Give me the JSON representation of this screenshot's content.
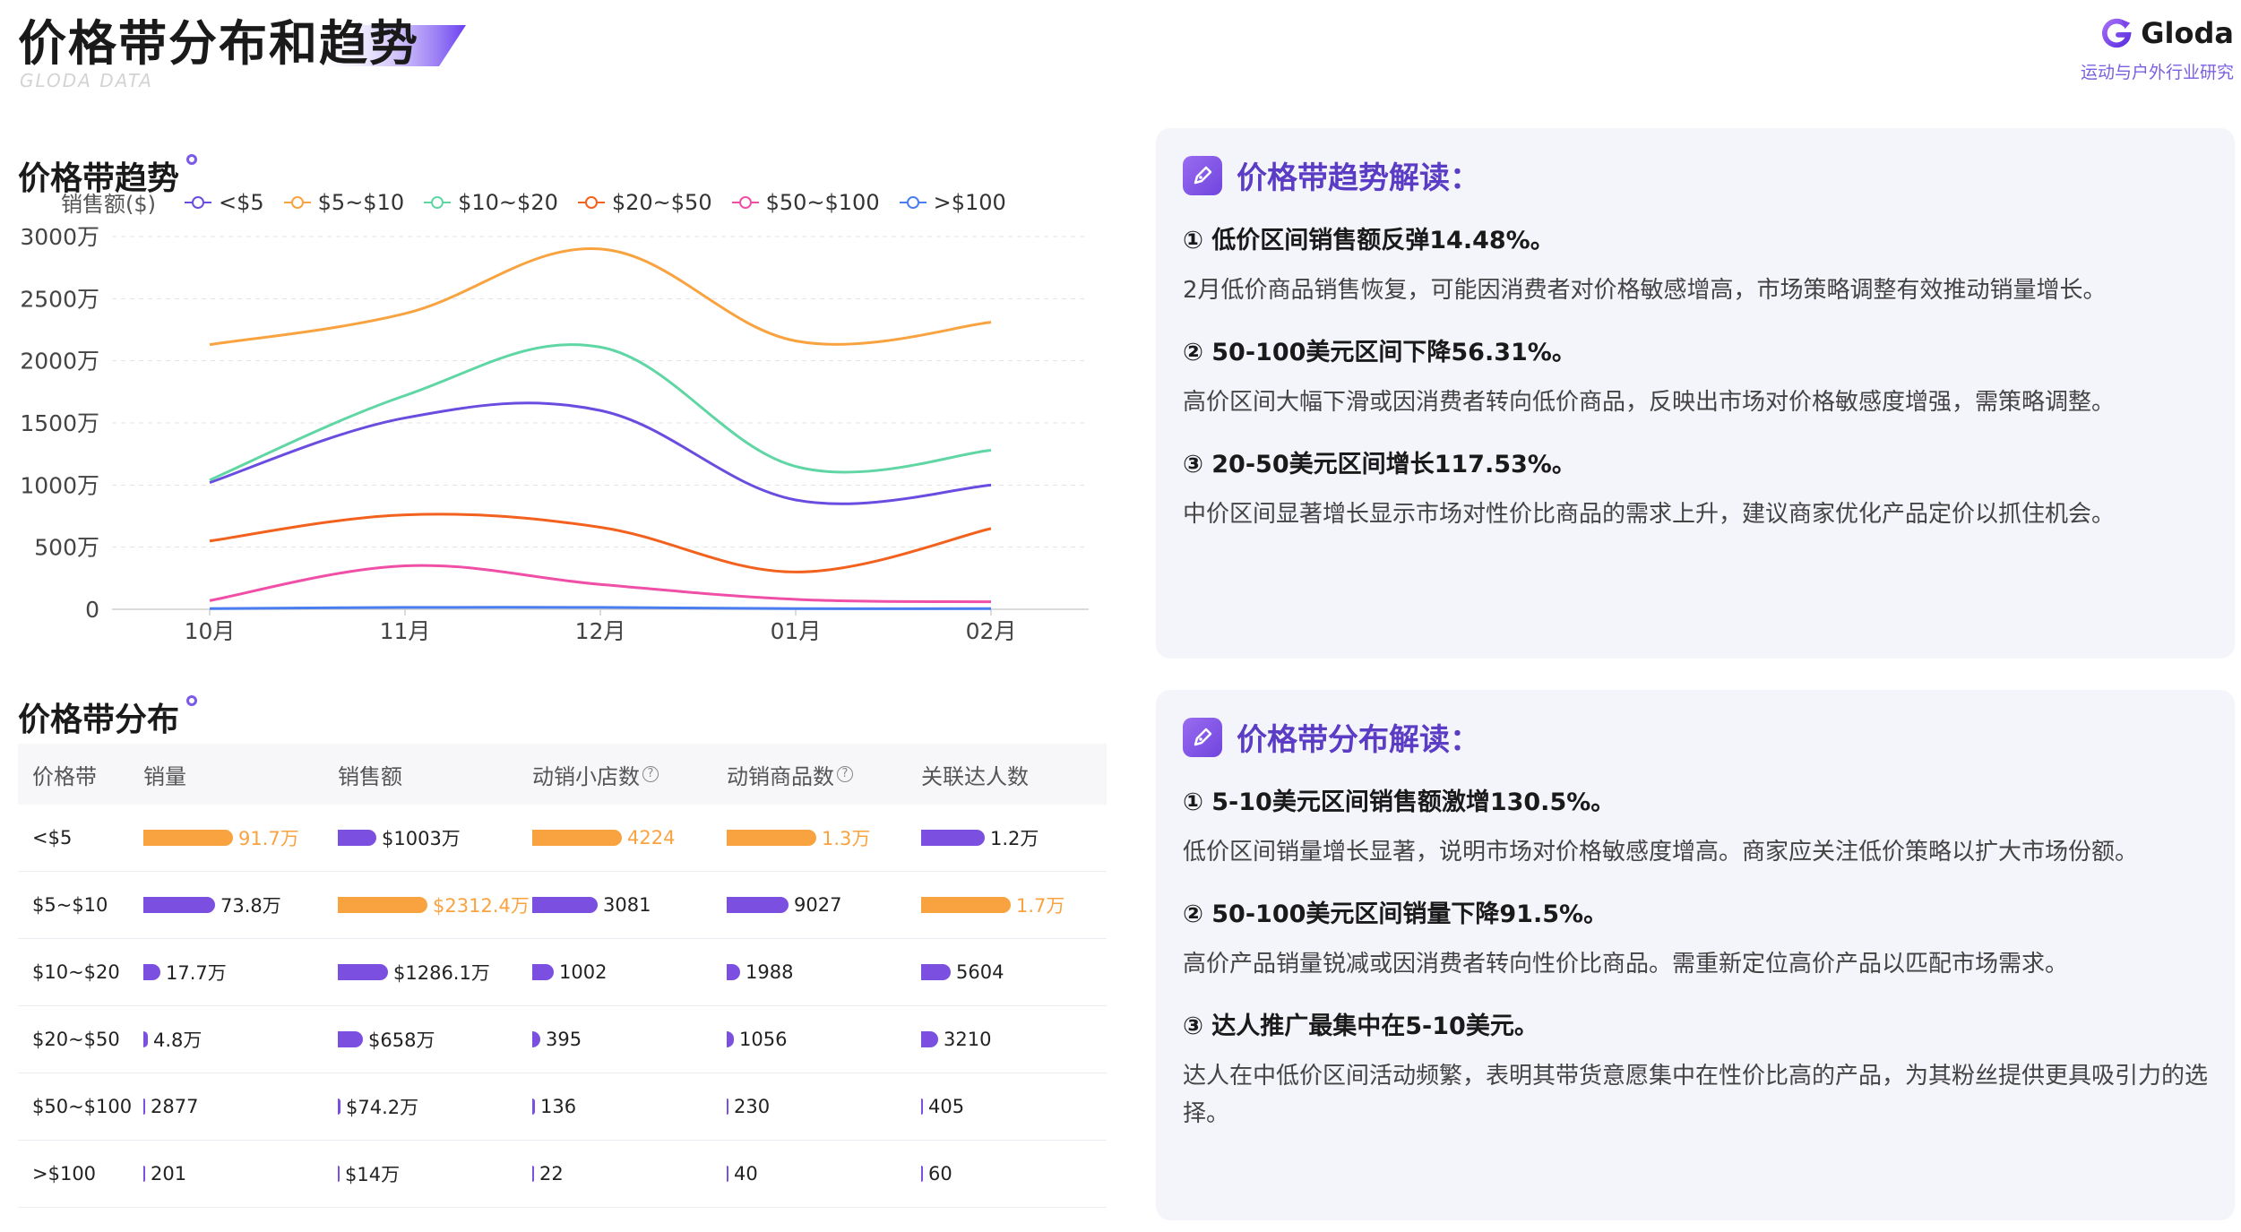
{
  "header": {
    "title": "价格带分布和趋势",
    "subtitle_en": "GLODA DATA",
    "brand_name": "Gloda",
    "brand_sub": "运动与户外行业研究"
  },
  "trend_section": {
    "title": "价格带趋势"
  },
  "dist_section": {
    "title": "价格带分布"
  },
  "chart_data": {
    "type": "line",
    "ylabel": "销售额($)",
    "categories": [
      "10月",
      "11月",
      "12月",
      "01月",
      "02月"
    ],
    "y_ticks": [
      "0",
      "500万",
      "1000万",
      "1500万",
      "2000万",
      "2500万",
      "3000万"
    ],
    "ylim": [
      0,
      3000
    ],
    "unit": "万",
    "grid": true,
    "legend_position": "top",
    "series": [
      {
        "name": "<$5",
        "color": "#6a4de0",
        "values": [
          1020,
          1540,
          1600,
          880,
          1000
        ]
      },
      {
        "name": "$5~$10",
        "color": "#f9a340",
        "values": [
          2130,
          2380,
          2900,
          2160,
          2310
        ]
      },
      {
        "name": "$10~$20",
        "color": "#5fd6a4",
        "values": [
          1040,
          1720,
          2110,
          1150,
          1280
        ]
      },
      {
        "name": "$20~$50",
        "color": "#f2611d",
        "values": [
          550,
          760,
          660,
          300,
          650
        ]
      },
      {
        "name": "$50~$100",
        "color": "#ef4fa6",
        "values": [
          70,
          350,
          200,
          80,
          60
        ]
      },
      {
        "name": ">$100",
        "color": "#4a7df0",
        "values": [
          5,
          15,
          15,
          5,
          5
        ]
      }
    ]
  },
  "table": {
    "headers": [
      "价格带",
      "销量",
      "销售额",
      "动销小店数",
      "动销商品数",
      "关联达人数"
    ],
    "help_mark": "?",
    "rows": [
      {
        "band": "<$5",
        "cells": [
          {
            "text": "91.7万",
            "fill": 1.0,
            "highlight": true
          },
          {
            "text": "$1003万",
            "fill": 0.43,
            "highlight": false
          },
          {
            "text": "4224",
            "fill": 1.0,
            "highlight": true
          },
          {
            "text": "1.3万",
            "fill": 1.0,
            "highlight": true
          },
          {
            "text": "1.2万",
            "fill": 0.71,
            "highlight": false
          }
        ]
      },
      {
        "band": "$5~$10",
        "cells": [
          {
            "text": "73.8万",
            "fill": 0.8,
            "highlight": false
          },
          {
            "text": "$2312.4万",
            "fill": 1.0,
            "highlight": true
          },
          {
            "text": "3081",
            "fill": 0.73,
            "highlight": false
          },
          {
            "text": "9027",
            "fill": 0.69,
            "highlight": false
          },
          {
            "text": "1.7万",
            "fill": 1.0,
            "highlight": true
          }
        ]
      },
      {
        "band": "$10~$20",
        "cells": [
          {
            "text": "17.7万",
            "fill": 0.19,
            "highlight": false
          },
          {
            "text": "$1286.1万",
            "fill": 0.56,
            "highlight": false
          },
          {
            "text": "1002",
            "fill": 0.24,
            "highlight": false
          },
          {
            "text": "1988",
            "fill": 0.15,
            "highlight": false
          },
          {
            "text": "5604",
            "fill": 0.33,
            "highlight": false
          }
        ]
      },
      {
        "band": "$20~$50",
        "cells": [
          {
            "text": "4.8万",
            "fill": 0.05,
            "highlight": false
          },
          {
            "text": "$658万",
            "fill": 0.28,
            "highlight": false
          },
          {
            "text": "395",
            "fill": 0.09,
            "highlight": false
          },
          {
            "text": "1056",
            "fill": 0.08,
            "highlight": false
          },
          {
            "text": "3210",
            "fill": 0.19,
            "highlight": false
          }
        ]
      },
      {
        "band": "$50~$100",
        "cells": [
          {
            "text": "2877",
            "fill": 0.003,
            "highlight": false
          },
          {
            "text": "$74.2万",
            "fill": 0.03,
            "highlight": false
          },
          {
            "text": "136",
            "fill": 0.03,
            "highlight": false
          },
          {
            "text": "230",
            "fill": 0.02,
            "highlight": false
          },
          {
            "text": "405",
            "fill": 0.02,
            "highlight": false
          }
        ]
      },
      {
        "band": ">$100",
        "cells": [
          {
            "text": "201",
            "fill": 0.0,
            "highlight": false
          },
          {
            "text": "$14万",
            "fill": 0.006,
            "highlight": false
          },
          {
            "text": "22",
            "fill": 0.005,
            "highlight": false
          },
          {
            "text": "40",
            "fill": 0.003,
            "highlight": false
          },
          {
            "text": "60",
            "fill": 0.004,
            "highlight": false
          }
        ]
      }
    ]
  },
  "trend_card": {
    "title": "价格带趋势解读：",
    "points": [
      {
        "title": "① 低价区间销售额反弹14.48%。",
        "body": "2月低价商品销售恢复，可能因消费者对价格敏感增高，市场策略调整有效推动销量增长。"
      },
      {
        "title": "② 50-100美元区间下降56.31%。",
        "body": "高价区间大幅下滑或因消费者转向低价商品，反映出市场对价格敏感度增强，需策略调整。"
      },
      {
        "title": "③ 20-50美元区间增长117.53%。",
        "body": "中价区间显著增长显示市场对性价比商品的需求上升，建议商家优化产品定价以抓住机会。"
      }
    ]
  },
  "dist_card": {
    "title": "价格带分布解读：",
    "points": [
      {
        "title": "① 5-10美元区间销售额激增130.5%。",
        "body": "低价区间销量增长显著，说明市场对价格敏感度增高。商家应关注低价策略以扩大市场份额。"
      },
      {
        "title": "② 50-100美元区间销量下降91.5%。",
        "body": "高价产品销量锐减或因消费者转向性价比商品。需重新定位高价产品以匹配市场需求。"
      },
      {
        "title": "③ 达人推广最集中在5-10美元。",
        "body": "达人在中低价区间活动频繁，表明其带货意愿集中在性价比高的产品，为其粉丝提供更具吸引力的选择。"
      }
    ]
  }
}
